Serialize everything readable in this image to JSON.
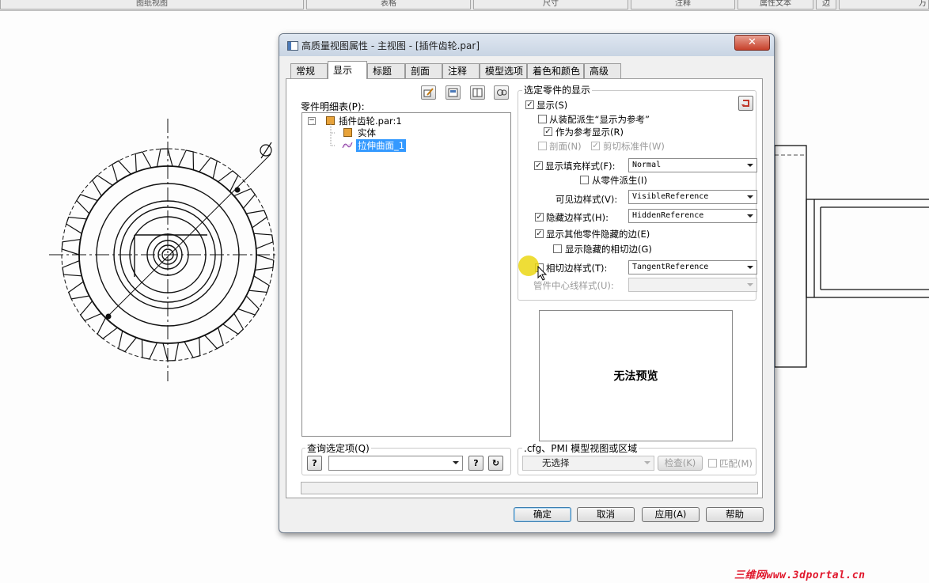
{
  "background_toolbar": [
    "图纸视图",
    "表格",
    "尺寸",
    "注释",
    "属性文本",
    "边",
    "万"
  ],
  "watermark": "三维网www.3dportal.cn",
  "dialog": {
    "title": "高质量视图属性 - 主视图 - [插件齿轮.par]",
    "close_label": "✕",
    "tabs": [
      "常规",
      "显示",
      "标题",
      "剖面",
      "注释",
      "模型选项",
      "着色和颜色",
      "高级"
    ],
    "active_tab": "显示",
    "parts_list": {
      "label": "零件明细表(P):",
      "root": "插件齿轮.par:1",
      "children": [
        "实体",
        "拉伸曲面_1"
      ],
      "selected": "拉伸曲面_1"
    },
    "display_group": {
      "title": "选定零件的显示",
      "show": {
        "label": "显示(S)",
        "checked": true
      },
      "derive_from_assembly": {
        "label": "从装配派生“显示为参考”",
        "checked": false
      },
      "show_as_reference": {
        "label": "作为参考显示(R)",
        "checked": true
      },
      "section": {
        "label": "剖面(N)",
        "checked": false,
        "enabled": false
      },
      "clip_plane": {
        "label": "剪切标准件(W)",
        "checked": true,
        "enabled": false
      },
      "fill_style": {
        "label": "显示填充样式(F):",
        "checked": true,
        "value": "Normal"
      },
      "derive_from_part": {
        "label": "从零件派生(I)",
        "checked": false
      },
      "visible_edge": {
        "label": "可见边样式(V):",
        "value": "VisibleReference"
      },
      "hidden_edge": {
        "label": "隐藏边样式(H):",
        "checked": true,
        "value": "HiddenReference"
      },
      "show_other_hidden": {
        "label": "显示其他零件隐藏的边(E)",
        "checked": true
      },
      "show_hidden_tangent": {
        "label": "显示隐藏的相切边(G)",
        "checked": false
      },
      "tangent_edge": {
        "label": "相切边样式(T):",
        "checked": false,
        "value": "TangentReference"
      },
      "pipe_centerline": {
        "label": "管件中心线样式(U):",
        "value": ""
      }
    },
    "preview_text": "无法预览",
    "query": {
      "label": "查询选定项(Q)",
      "value": ""
    },
    "cfg": {
      "label": ".cfg、PMI 模型视图或区域",
      "value": "无选择",
      "check_label": "检查(K)",
      "match_label": "匹配(M)"
    },
    "buttons": {
      "ok": "确定",
      "cancel": "取消",
      "apply": "应用(A)",
      "help": "帮助"
    },
    "help_glyph": "?",
    "run_glyph": "↻"
  }
}
